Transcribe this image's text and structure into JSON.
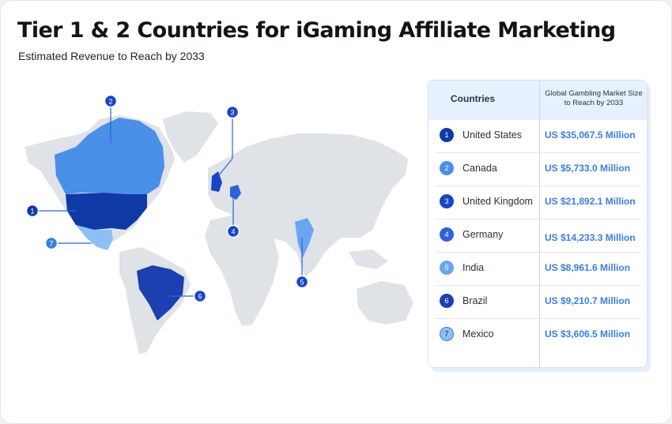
{
  "title": "Tier 1 & 2 Countries for iGaming Affiliate Marketing",
  "subtitle": "Estimated Revenue to Reach by 2033",
  "colors": {
    "land": "#dfe2e6",
    "accent": "#3a7ee0",
    "table_header_bg": "#e7f0fd"
  },
  "table": {
    "header_countries": "Countries",
    "header_market": "Global Gambling Market Size to Reach by 2033",
    "rows": [
      {
        "num": "1",
        "country": "United States",
        "value": "US $35,067.5 Million",
        "color": "#0f3aa6"
      },
      {
        "num": "2",
        "country": "Canada",
        "value": "US $5,733.0 Million",
        "color": "#4a8fe8"
      },
      {
        "num": "3",
        "country": "United Kingdom",
        "value": "US $21,892.1 Million",
        "color": "#1845c4"
      },
      {
        "num": "4",
        "country": "Germany",
        "value": "US $14,233.3 Million",
        "color": "#2c64d8"
      },
      {
        "num": "5",
        "country": "India",
        "value": "US $8,961.6 Million",
        "color": "#6aa5f0"
      },
      {
        "num": "6",
        "country": "Brazil",
        "value": "US $9,210.7 Million",
        "color": "#1e3fb0"
      },
      {
        "num": "7",
        "country": "Mexico",
        "value": "US $3,606.5 Million",
        "color": "#8cc0f5"
      }
    ]
  },
  "map_pins": [
    {
      "num": "1",
      "country": "United States"
    },
    {
      "num": "2",
      "country": "Canada"
    },
    {
      "num": "3",
      "country": "United Kingdom"
    },
    {
      "num": "4",
      "country": "Germany"
    },
    {
      "num": "5",
      "country": "India"
    },
    {
      "num": "6",
      "country": "Brazil"
    },
    {
      "num": "7",
      "country": "Mexico"
    }
  ]
}
